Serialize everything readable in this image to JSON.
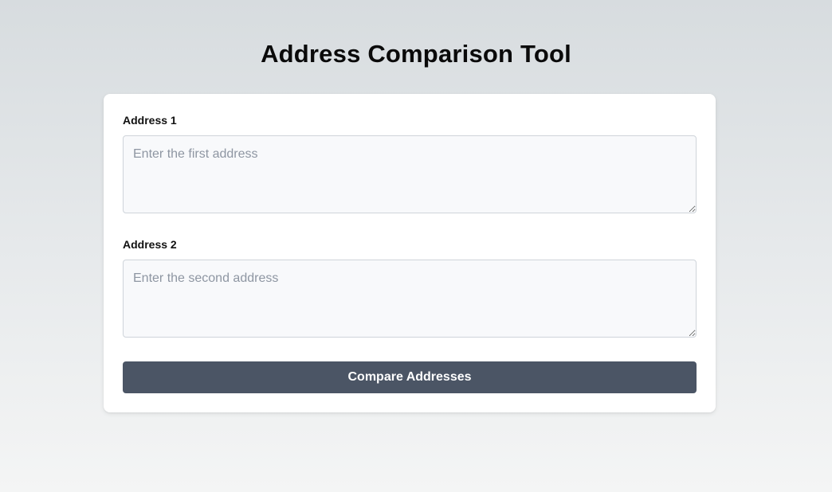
{
  "page": {
    "title": "Address Comparison Tool"
  },
  "form": {
    "address1": {
      "label": "Address 1",
      "value": "",
      "placeholder": "Enter the first address"
    },
    "address2": {
      "label": "Address 2",
      "value": "",
      "placeholder": "Enter the second address"
    },
    "submit_label": "Compare Addresses"
  },
  "colors": {
    "button_background": "#4b5565",
    "button_text": "#ffffff",
    "card_background": "#ffffff",
    "input_background": "#f8f9fb",
    "placeholder_text": "#8e96a2"
  }
}
